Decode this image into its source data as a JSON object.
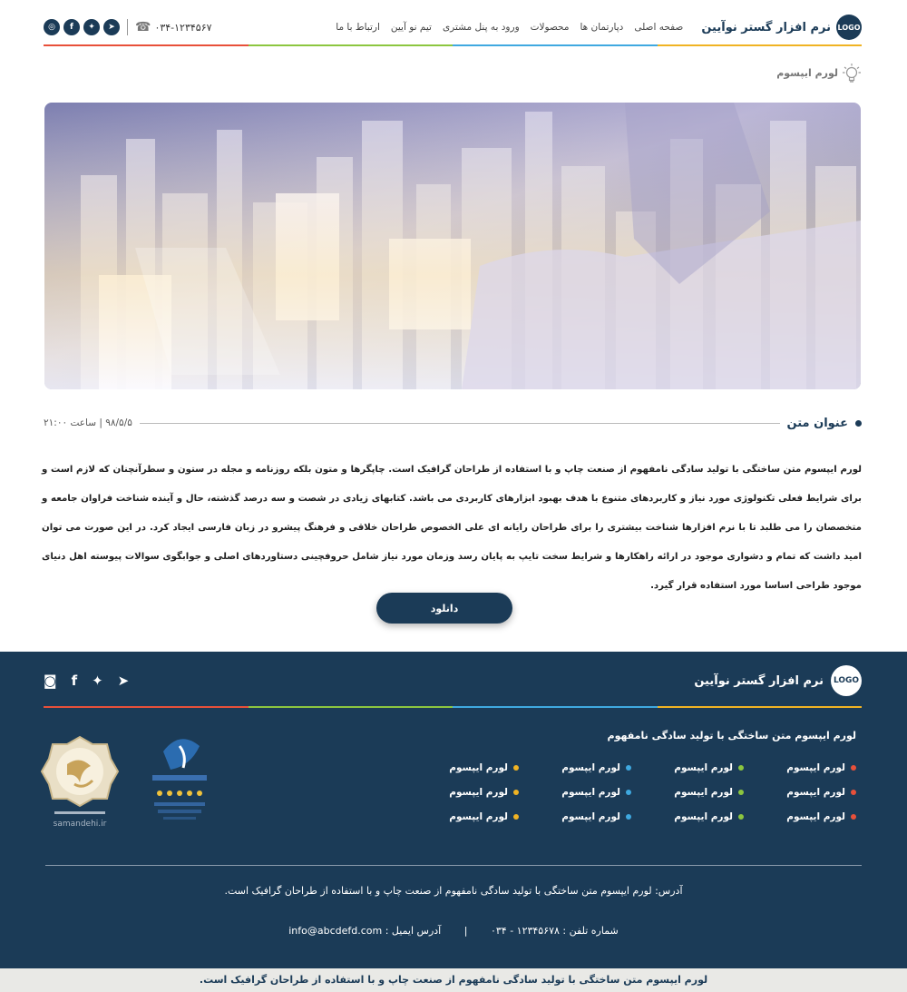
{
  "header": {
    "logo": "LOGO",
    "brand": "نرم افزار گستر نوآیین",
    "nav": [
      "صفحه اصلی",
      "دپارتمان ها",
      "محصولات",
      "ورود به پنل مشتری",
      "تیم نو آیین",
      "ارتباط با ما"
    ],
    "phone": "۰۳۴-۱۲۳۴۵۶۷",
    "social_icons": [
      "telegram-icon",
      "twitter-icon",
      "facebook-icon",
      "instagram-icon"
    ]
  },
  "stripe_colors": [
    "#f0b323",
    "#3fa9e0",
    "#8cc63f",
    "#e8503a"
  ],
  "breadcrumb": {
    "label": "لورم ایپسوم"
  },
  "post": {
    "title": "عنوان متن",
    "date": "۹۸/۵/۵ | ساعت ۲۱:۰۰",
    "body": "لورم ایپسوم متن ساختگی با تولید سادگی نامفهوم از صنعت چاپ و با استفاده از طراحان گرافیک است. چاپگرها و متون بلکه روزنامه و مجله در ستون و سطرآنچنان که لازم است و برای شرایط فعلی تکنولوژی مورد نیاز و کاربردهای متنوع با هدف بهبود ابزارهای کاربردی می باشد. کتابهای زیادی در شصت و سه درصد گذشته، حال و آینده شناخت فراوان جامعه و متخصصان را می طلبد تا با نرم افزارها شناخت بیشتری را برای طراحان رایانه ای علی الخصوص طراحان خلاقی و فرهنگ پیشرو در زبان فارسی ایجاد کرد. در این صورت می توان امید داشت که تمام و دشواری موجود در ارائه راهکارها و شرایط سخت تایپ به پایان رسد وزمان مورد نیاز شامل حروفچینی دستاوردهای اصلی و جوابگوی سوالات پیوسته اهل دنیای موجود طراحی اساسا مورد استفاده قرار گیرد.",
    "download_label": "دانلود"
  },
  "footer": {
    "logo": "LOGO",
    "brand": "نرم افزار گستر نوآیین",
    "tagline": "لورم ایپسوم متن ساختگی با تولید سادگی نامفهوم",
    "link_columns": [
      {
        "color": "#e8503a",
        "items": [
          "لورم ایپسوم",
          "لورم ایپسوم",
          "لورم ایپسوم"
        ]
      },
      {
        "color": "#8cc63f",
        "items": [
          "لورم ایپسوم",
          "لورم ایپسوم",
          "لورم ایپسوم"
        ]
      },
      {
        "color": "#3fa9e0",
        "items": [
          "لورم ایپسوم",
          "لورم ایپسوم",
          "لورم ایپسوم"
        ]
      },
      {
        "color": "#f0b323",
        "items": [
          "لورم ایپسوم",
          "لورم ایپسوم",
          "لورم ایپسوم"
        ]
      }
    ],
    "samandehi_caption": "samandehi.ir",
    "address": "آدرس: لورم ایپسوم متن ساختگی با تولید سادگی نامفهوم از صنعت چاپ و با استفاده از طراحان گرافیک است.",
    "phone": "شماره تلفن : ۱۲۳۴۵۶۷۸ - ۰۳۴",
    "email": "آدرس ایمیل : info@abcdefd.com",
    "copyright": "لورم ایپسوم متن ساختگی با تولید سادگی نامفهوم از صنعت چاپ و با استفاده از طراحان گرافیک است."
  },
  "colors": {
    "primary": "#1b3b57",
    "copyright_bg": "#e9e9e6"
  }
}
